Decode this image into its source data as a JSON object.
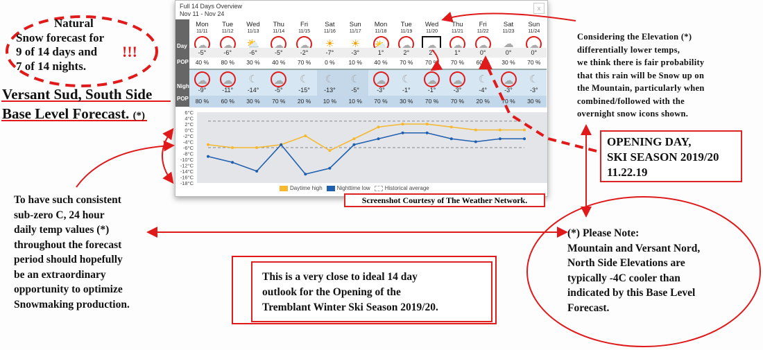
{
  "widget": {
    "title": "Full 14 Days Overview",
    "range": "Nov 11 - Nov 24",
    "close": "x",
    "row_labels": {
      "day": "Day",
      "pop": "POP",
      "night": "Night",
      "npop": "POP"
    },
    "days": [
      {
        "name": "Mon",
        "date": "11/11",
        "day_icon": "snow-icon",
        "high": "-5°",
        "pop": "40 %",
        "night_icon": "snow-icon",
        "low": "-9°",
        "npop": "80 %"
      },
      {
        "name": "Tue",
        "date": "11/12",
        "day_icon": "snow-icon",
        "high": "-6°",
        "pop": "80 %",
        "night_icon": "snow-icon",
        "low": "-11°",
        "npop": "60 %"
      },
      {
        "name": "Wed",
        "date": "11/13",
        "day_icon": "sun-cloud-icon",
        "high": "-6°",
        "pop": "30 %",
        "night_icon": "moon-cloud-icon",
        "low": "-14°",
        "npop": "30 %"
      },
      {
        "name": "Thu",
        "date": "11/14",
        "day_icon": "snow-icon",
        "high": "-5°",
        "pop": "40 %",
        "night_icon": "snow-icon",
        "low": "-5°",
        "npop": "70 %"
      },
      {
        "name": "Fri",
        "date": "11/15",
        "day_icon": "snow-icon",
        "high": "-2°",
        "pop": "70 %",
        "night_icon": "moon-cloud-icon",
        "low": "-15°",
        "npop": "20 %"
      },
      {
        "name": "Sat",
        "date": "11/16",
        "day_icon": "sun-icon",
        "high": "-7°",
        "pop": "0 %",
        "night_icon": "moon-icon",
        "low": "-13°",
        "npop": "10 %"
      },
      {
        "name": "Sun",
        "date": "11/17",
        "day_icon": "sun-icon",
        "high": "-3°",
        "pop": "10 %",
        "night_icon": "moon-icon",
        "low": "-5°",
        "npop": "10 %"
      },
      {
        "name": "Mon",
        "date": "11/18",
        "day_icon": "sun-cloud-snow-icon",
        "high": "1°",
        "pop": "40 %",
        "night_icon": "snow-icon",
        "low": "-3°",
        "npop": "70 %"
      },
      {
        "name": "Tue",
        "date": "11/19",
        "day_icon": "rain-snow-icon",
        "high": "2°",
        "pop": "70 %",
        "night_icon": "moon-cloud-icon",
        "low": "-1°",
        "npop": "30 %"
      },
      {
        "name": "Wed",
        "date": "11/20",
        "day_icon": "rain-icon",
        "high": "2°",
        "pop": "70 %",
        "night_icon": "snow-icon",
        "low": "-1°",
        "npop": "70 %"
      },
      {
        "name": "Thu",
        "date": "11/21",
        "day_icon": "snow-icon",
        "high": "1°",
        "pop": "70 %",
        "night_icon": "snow-icon",
        "low": "-3°",
        "npop": "70 %"
      },
      {
        "name": "Fri",
        "date": "11/22",
        "day_icon": "snow-icon",
        "high": "0°",
        "pop": "60 %",
        "night_icon": "moon-cloud-icon",
        "low": "-4°",
        "npop": "20 %"
      },
      {
        "name": "Sat",
        "date": "11/23",
        "day_icon": "cloud-icon",
        "high": "0°",
        "pop": "30 %",
        "night_icon": "snow-icon",
        "low": "-3°",
        "npop": "70 %"
      },
      {
        "name": "Sun",
        "date": "11/24",
        "day_icon": "snow-icon",
        "high": "0°",
        "pop": "70 %",
        "night_icon": "moon-cloud-icon",
        "low": "-3°",
        "npop": "30 %"
      }
    ]
  },
  "chart_data": {
    "type": "line",
    "x": [
      "11/11",
      "11/12",
      "11/13",
      "11/14",
      "11/15",
      "11/16",
      "11/17",
      "11/18",
      "11/19",
      "11/20",
      "11/21",
      "11/22",
      "11/23",
      "11/24"
    ],
    "series": [
      {
        "name": "Daytime high",
        "color": "#f5b82e",
        "values": [
          -5,
          -6,
          -6,
          -5,
          -2,
          -7,
          -3,
          1,
          2,
          2,
          1,
          0,
          0,
          0
        ]
      },
      {
        "name": "Nighttime low",
        "color": "#1f5fb0",
        "values": [
          -9,
          -11,
          -14,
          -5,
          -15,
          -13,
          -5,
          -3,
          -1,
          -1,
          -3,
          -4,
          -3,
          -3
        ]
      }
    ],
    "historical_average": {
      "name": "Historical average",
      "values": [
        3,
        -6
      ]
    },
    "ylim": [
      -18,
      6
    ],
    "yticks": [
      "6°C",
      "4°C",
      "2°C",
      "0°C",
      "-2°C",
      "-4°C",
      "-6°C",
      "-8°C",
      "-10°C",
      "-12°C",
      "-14°C",
      "-16°C",
      "-18°C"
    ],
    "grid": false,
    "legend": "bottom"
  },
  "annotations": {
    "snow_title": "Natural",
    "snow_l1": "Snow forecast for",
    "snow_l2": "9 of 14 days and",
    "snow_l3": "7 of 14 nights.",
    "exclaim": "!!!",
    "base_l1": "Versant Sud, South Side",
    "base_l2": "Base Level Forecast.",
    "base_star": "(*)",
    "left_text": [
      "To have such consistent",
      "sub-zero C, 24 hour",
      "daily temp values  (*)",
      "throughout the forecast",
      "period should hopefully",
      "be an extraordinary",
      "opportunity to optimize",
      "Snowmaking production."
    ],
    "right_text": [
      "Considering the Elevation  (*)",
      "differentially lower temps,",
      "we think there is fair probability",
      "that this rain will be Snow up on",
      "the  Mountain, particularly when",
      "combined/followed with the",
      "overnight snow icons shown."
    ],
    "opening": [
      "OPENING DAY,",
      "SKI SEASON 2019/20",
      "11.22.19"
    ],
    "courtesy": "Screenshot Courtesy of The Weather Network.",
    "center": [
      "This is a very close to ideal 14 day",
      "outlook for the Opening of the",
      "Tremblant Winter Ski Season 2019/20."
    ],
    "note": [
      "(*) Please Note:",
      "Mountain and Versant Nord,",
      "North Side Elevations are",
      "typically -4C cooler than",
      "indicated by this Base Level",
      "Forecast."
    ]
  },
  "colors": {
    "annotation": "#e01a1a",
    "day_high": "#f5b82e",
    "night_low": "#1f5fb0"
  }
}
